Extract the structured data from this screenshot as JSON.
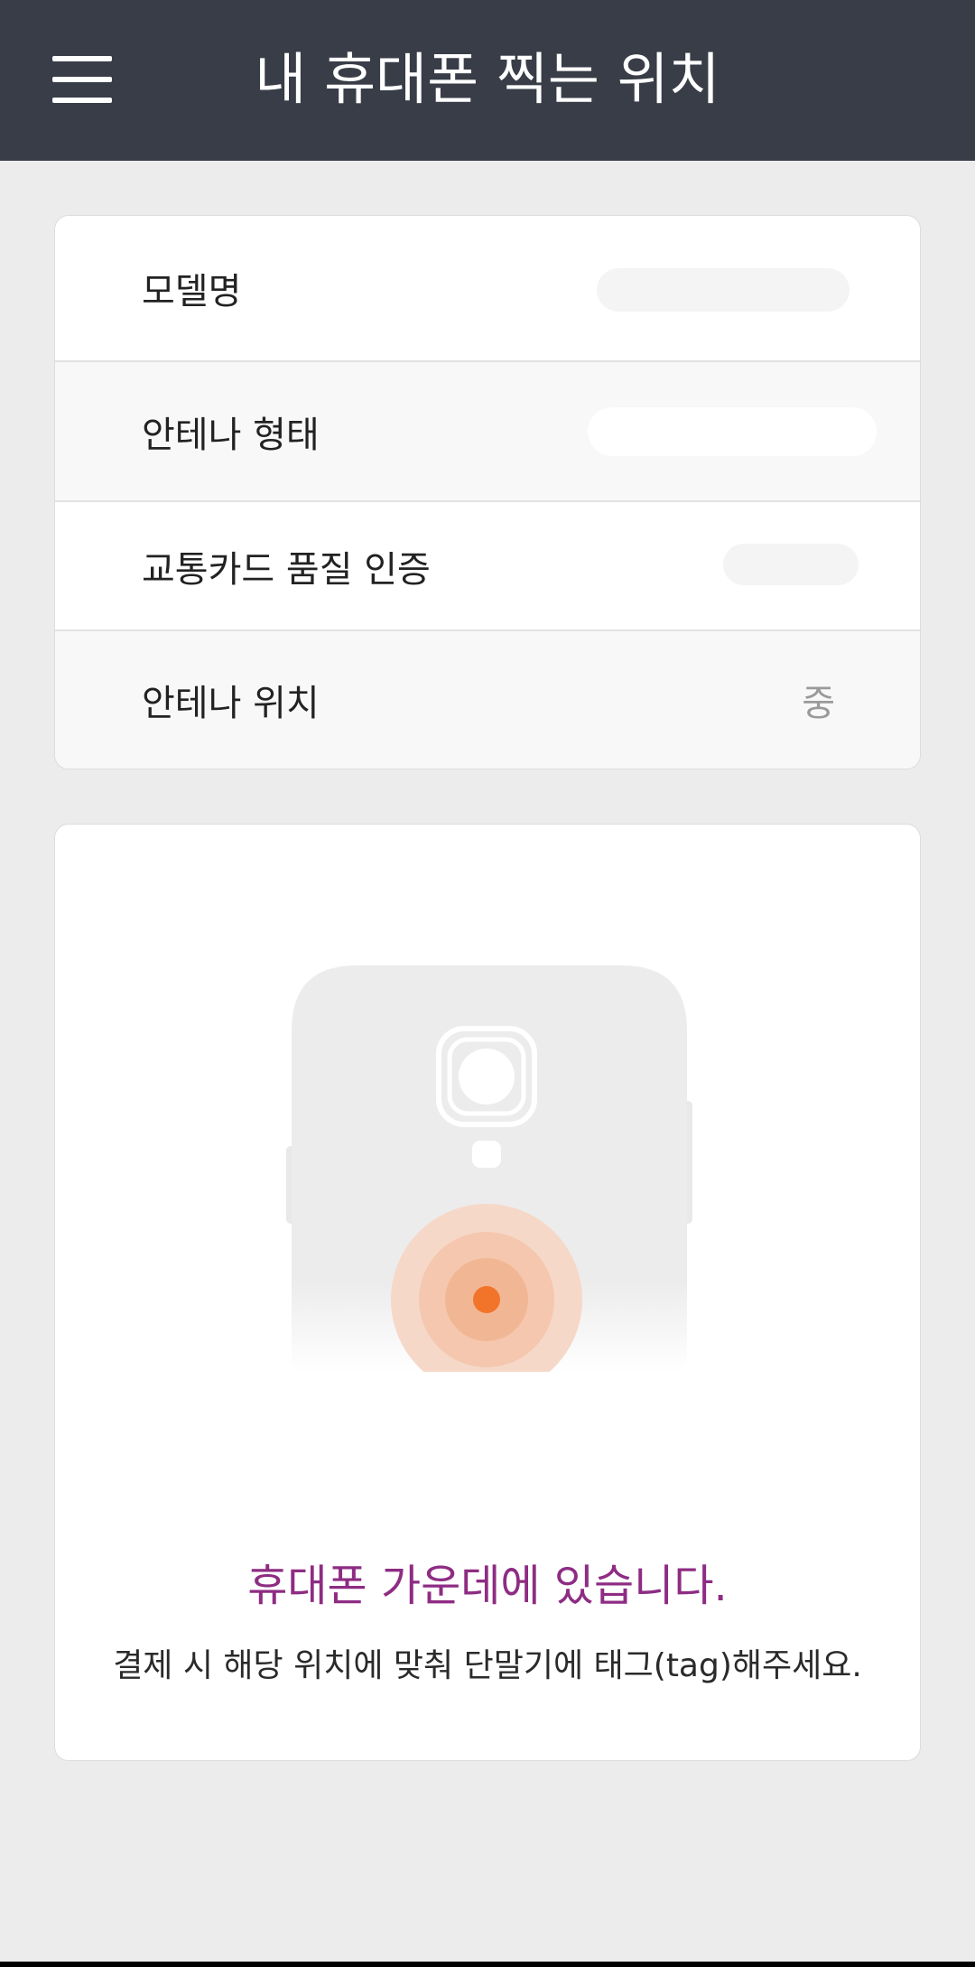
{
  "header": {
    "title": "내 휴대폰 찍는 위치"
  },
  "info": {
    "rows": [
      {
        "label": "모델명",
        "value": ""
      },
      {
        "label": "안테나 형태",
        "value": ""
      },
      {
        "label": "교통카드 품질 인증",
        "value": ""
      },
      {
        "label": "안테나 위치",
        "value": "중"
      }
    ]
  },
  "antenna": {
    "headline": "휴대폰 가운데에 있습니다.",
    "instruction": "결제 시 해당 위치에 맞춰 단말기에 태그(tag)해주세요."
  },
  "colors": {
    "appbar": "#383d47",
    "accent_purple": "#8e2c83",
    "nfc_orange": "#f2742b"
  },
  "icons": {
    "menu": "hamburger-menu-icon",
    "phone": "phone-back-illustration",
    "nfc": "nfc-target-icon"
  }
}
